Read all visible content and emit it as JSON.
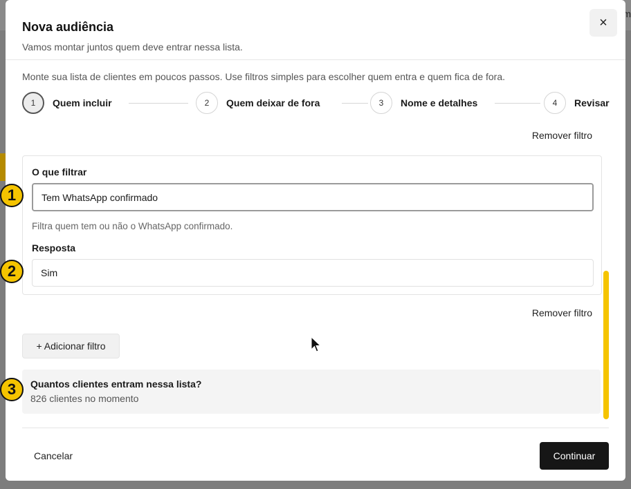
{
  "background": {
    "corner_text": "m"
  },
  "modal": {
    "title": "Nova audiência",
    "subtitle": "Vamos montar juntos quem deve entrar nessa lista.",
    "close_icon": "×",
    "intro": "Monte sua lista de clientes em poucos passos. Use filtros simples para escolher quem entra e quem fica de fora."
  },
  "steps": [
    {
      "number": "1",
      "label": "Quem incluir",
      "active": true
    },
    {
      "number": "2",
      "label": "Quem deixar de fora",
      "active": false
    },
    {
      "number": "3",
      "label": "Nome e detalhes",
      "active": false
    },
    {
      "number": "4",
      "label": "Revisar",
      "active": false
    }
  ],
  "filters": {
    "remove_label_top": "Remover filtro",
    "what_label": "O que filtrar",
    "what_value": "Tem WhatsApp confirmado",
    "help_text": "Filtra quem tem ou não o WhatsApp confirmado.",
    "answer_label": "Resposta",
    "answer_value": "Sim",
    "remove_label_bottom": "Remover filtro",
    "add_filter_label": "+ Adicionar filtro"
  },
  "count": {
    "question": "Quantos clientes entram nessa lista?",
    "value": "826 clientes no momento"
  },
  "footer": {
    "cancel_label": "Cancelar",
    "continue_label": "Continuar"
  },
  "badges": [
    "1",
    "2",
    "3"
  ],
  "colors": {
    "accent_yellow": "#f5c400",
    "primary_button": "#161616"
  }
}
